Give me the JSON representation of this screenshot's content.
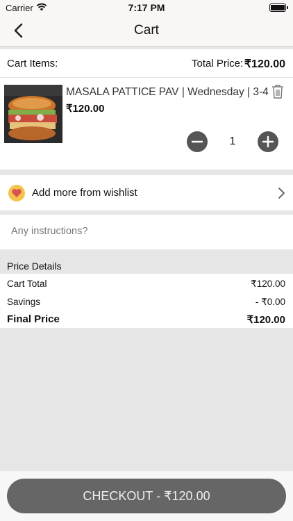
{
  "status_bar": {
    "carrier": "Carrier",
    "time": "7:17 PM"
  },
  "nav": {
    "title": "Cart",
    "back_icon": "chevron-left-icon"
  },
  "cart_header": {
    "label": "Cart Items:",
    "total_label": "Total Price:",
    "total_value": "₹120.00"
  },
  "item": {
    "name": "MASALA PATTICE PAV | Wednesday | 3-4",
    "price": "₹120.00",
    "quantity": "1",
    "image_alt": "masala pattice pav sandwich photo"
  },
  "wishlist": {
    "label": "Add more from wishlist"
  },
  "instructions": {
    "placeholder": "Any instructions?"
  },
  "price_details": {
    "header": "Price Details",
    "cart_total_label": "Cart Total",
    "cart_total_value": "₹120.00",
    "savings_label": "Savings",
    "savings_value": "- ₹0.00",
    "final_label": "Final Price",
    "final_value": "₹120.00"
  },
  "checkout": {
    "label": "CHECKOUT - ₹120.00"
  },
  "colors": {
    "nav_bg": "#fbf6f6",
    "page_bg": "#e6e6e6",
    "checkout_bg": "#666666",
    "heart_badge": "#f4c34a",
    "heart": "#d9534f"
  }
}
